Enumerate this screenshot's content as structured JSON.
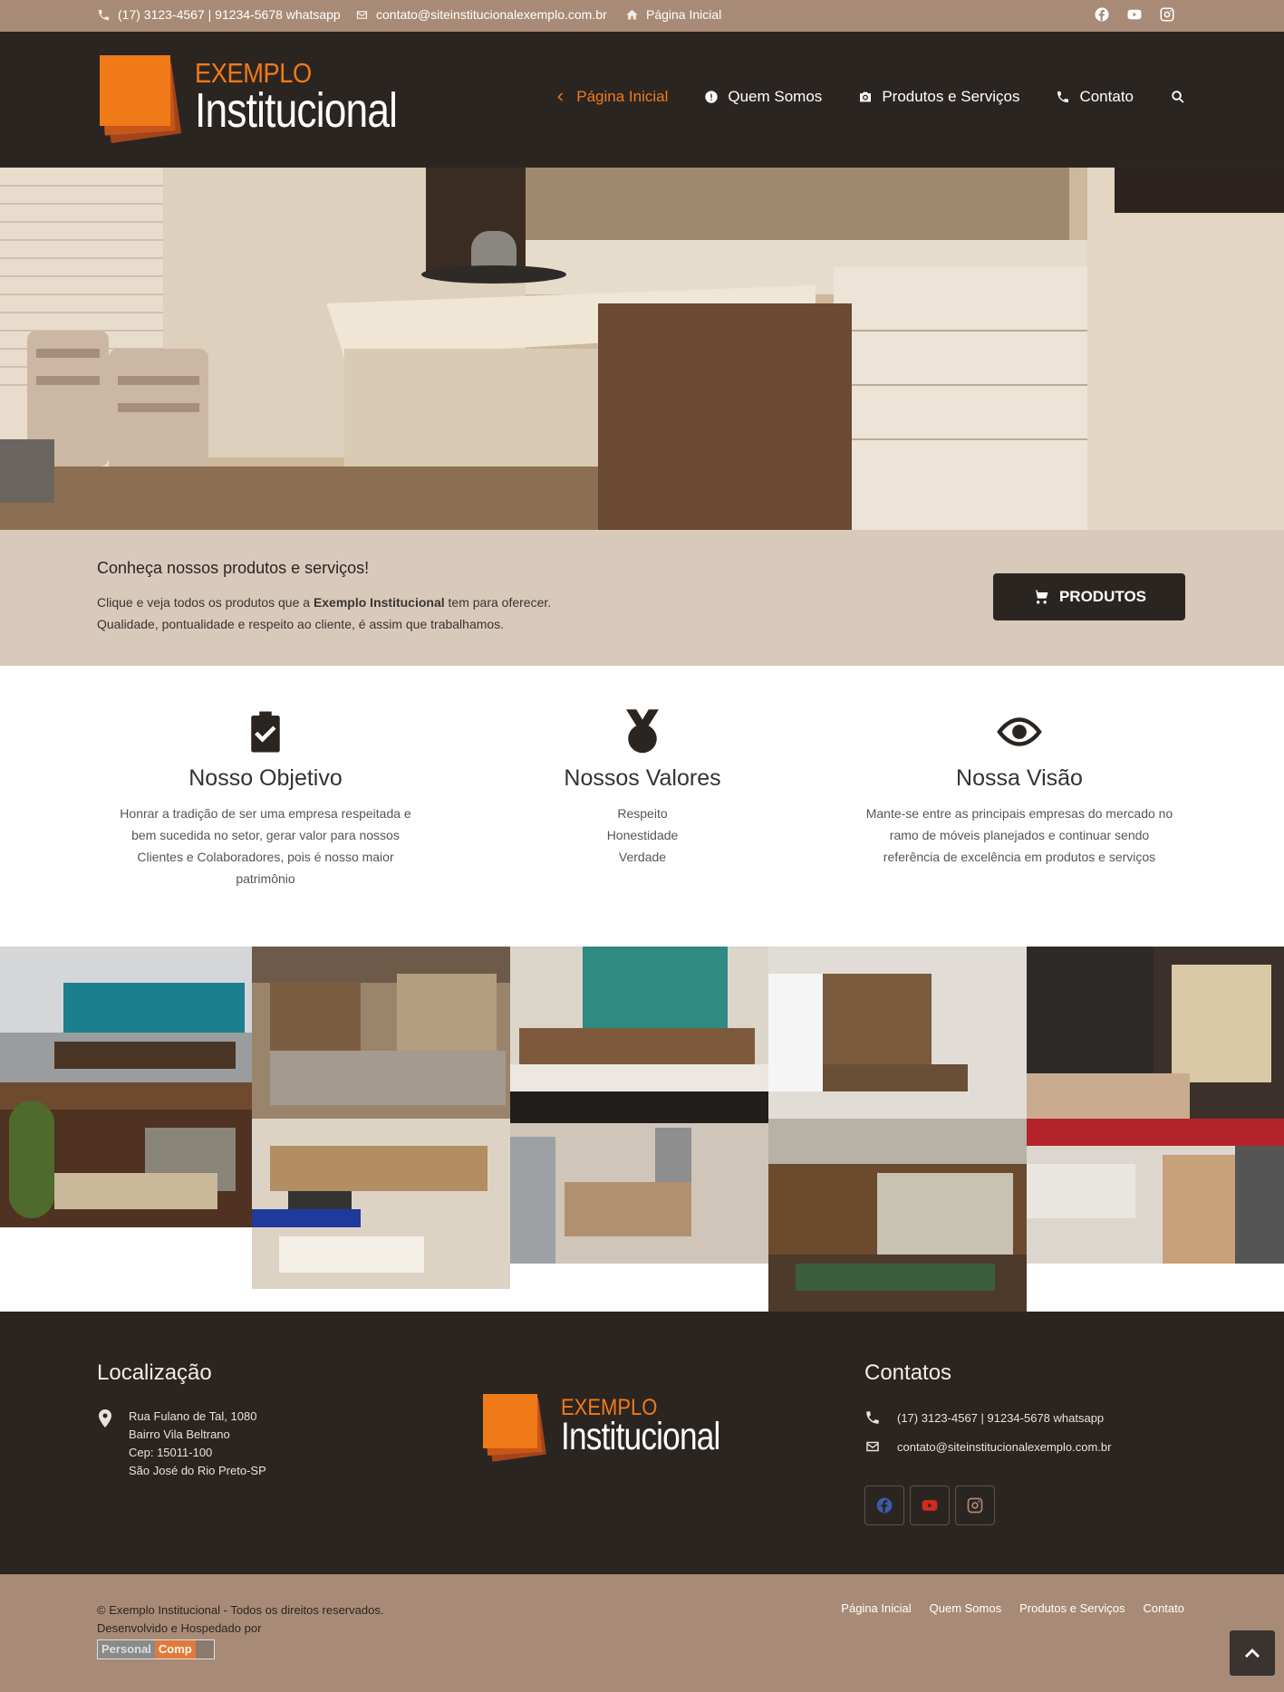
{
  "topbar": {
    "phone": "(17) 3123-4567 | 91234-5678 whatsapp",
    "email": "contato@siteinstitucionalexemplo.com.br",
    "home": "Página Inicial",
    "social_icons": [
      "facebook-icon",
      "youtube-icon",
      "instagram-icon"
    ]
  },
  "logo": {
    "line1": "EXEMPLO",
    "line2": "Institucional"
  },
  "nav": {
    "items": [
      {
        "label": "Página Inicial",
        "icon": "chevron-left-icon",
        "active": true
      },
      {
        "label": "Quem Somos",
        "icon": "exclamation-circle-icon"
      },
      {
        "label": "Produtos e Serviços",
        "icon": "camera-icon"
      },
      {
        "label": "Contato",
        "icon": "phone-icon"
      }
    ],
    "search_icon": "search-icon"
  },
  "cta": {
    "heading": "Conheça nossos produtos e serviços!",
    "text_before": "Clique e veja todos os produtos que a ",
    "text_bold": "Exemplo Institucional",
    "text_after": " tem para oferecer.",
    "line2": "Qualidade, pontualidade e respeito ao cliente, é assim que trabalhamos.",
    "button": "PRODUTOS"
  },
  "features": [
    {
      "icon": "clipboard-check-icon",
      "title": "Nosso Objetivo",
      "text": "Honrar a tradição de ser uma empresa respeitada e bem sucedida no setor, gerar valor para nossos Clientes e Colaboradores, pois é nosso maior patrimônio"
    },
    {
      "icon": "medal-icon",
      "title": "Nossos Valores",
      "lines": [
        "Respeito",
        "Honestidade",
        "Verdade"
      ]
    },
    {
      "icon": "eye-icon",
      "title": "Nossa Visão",
      "text": "Mante-se entre as principais empresas do mercado no ramo de móveis planejados e continuar sendo referência de excelência em produtos e serviços"
    }
  ],
  "footer": {
    "location_title": "Localização",
    "address": [
      "Rua Fulano de Tal, 1080",
      "Bairro Vila Beltrano",
      "Cep: 15011-100",
      "São José do Rio Preto-SP"
    ],
    "contacts_title": "Contatos",
    "phone": "(17) 3123-4567 | 91234-5678 whatsapp",
    "email": "contato@siteinstitucionalexemplo.com.br"
  },
  "bottom": {
    "copyright": "© Exemplo Institucional - Todos os direitos reservados.",
    "developed": "Desenvolvido e Hospedado por",
    "brand_left": "Personal",
    "brand_right": "Comp",
    "links": [
      "Página Inicial",
      "Quem Somos",
      "Produtos e Serviços",
      "Contato"
    ]
  },
  "colors": {
    "accent": "#f07a18",
    "dark": "#2b2522",
    "tan": "#a88b76",
    "cta_bg": "#d8c9bb"
  }
}
